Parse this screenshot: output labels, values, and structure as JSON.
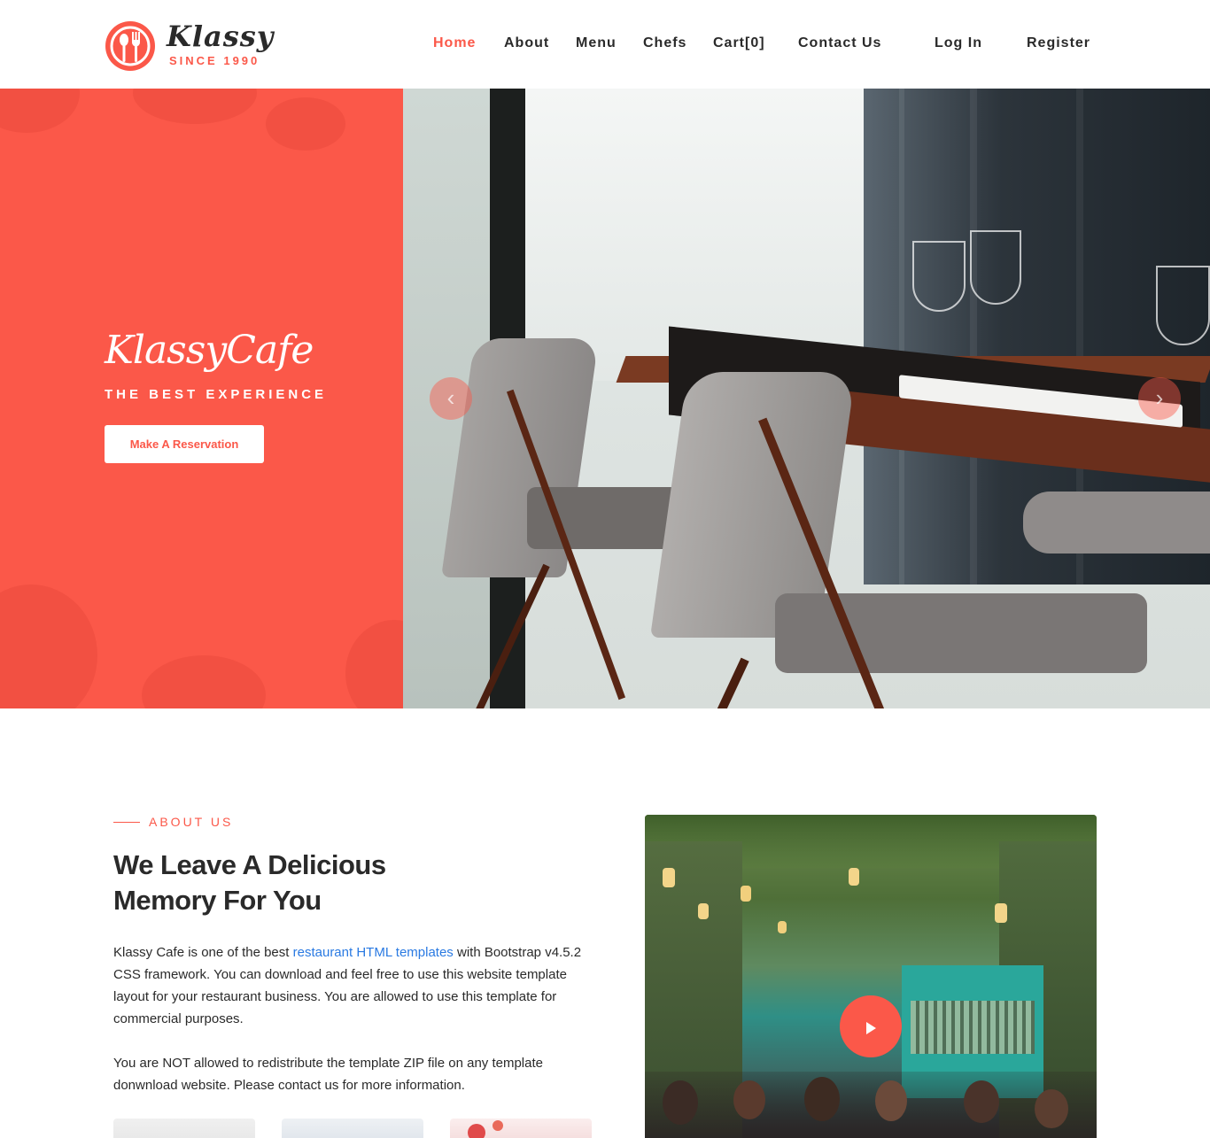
{
  "brand": {
    "name": "Klassy",
    "since": "SINCE 1990",
    "logo_icon": "plate-fork-spoon-icon",
    "accent_color": "#fb5849"
  },
  "nav": {
    "items": [
      {
        "label": "Home",
        "active": true
      },
      {
        "label": "About"
      },
      {
        "label": "Menu"
      },
      {
        "label": "Chefs"
      },
      {
        "label": "Cart[0]"
      },
      {
        "label": "Contact Us"
      },
      {
        "label": "Log In"
      },
      {
        "label": "Register"
      }
    ]
  },
  "hero": {
    "title": "KlassyCafe",
    "subtitle": "THE BEST EXPERIENCE",
    "button_label": "Make A Reservation",
    "prev_icon": "chevron-left-icon",
    "next_icon": "chevron-right-icon"
  },
  "about": {
    "label": "ABOUT US",
    "heading_line1": "We Leave A Delicious",
    "heading_line2": "Memory For You",
    "p1_before": "Klassy Cafe is one of the best ",
    "p1_link": "restaurant HTML templates",
    "p1_after": " with Bootstrap v4.5.2 CSS framework. You can download and feel free to use this website template layout for your restaurant business. You are allowed to use this template for commercial purposes.",
    "p2": "You are NOT allowed to redistribute the template ZIP file on any template donwnload website. Please contact us for more information.",
    "video_icon": "play-icon"
  }
}
